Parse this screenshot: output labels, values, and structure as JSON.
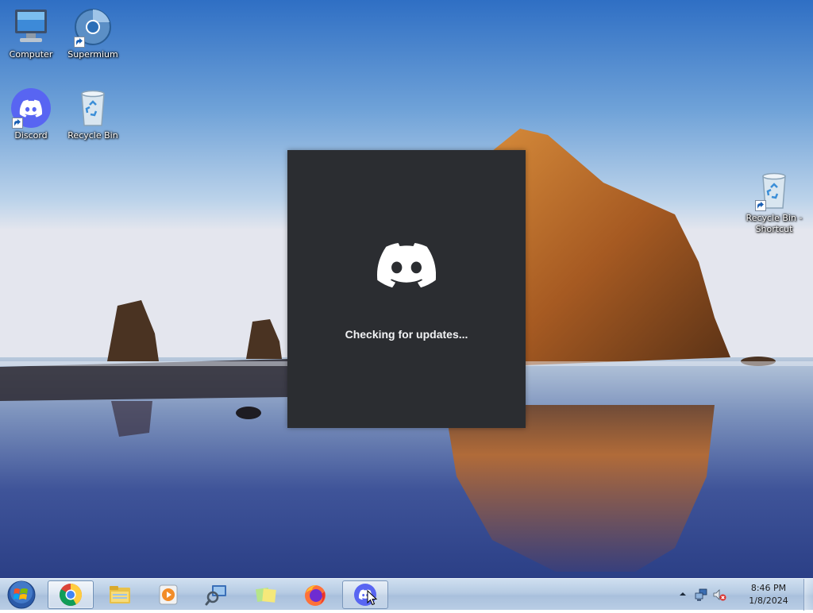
{
  "desktop": {
    "icons": [
      {
        "label": "Computer",
        "icon": "computer-icon",
        "shortcut": false
      },
      {
        "label": "Supermium",
        "icon": "supermium-icon",
        "shortcut": true
      },
      {
        "label": "Discord",
        "icon": "discord-icon",
        "shortcut": true
      },
      {
        "label": "Recycle Bin",
        "icon": "recycle-bin-icon",
        "shortcut": false
      },
      {
        "label": "Recycle Bin - Shortcut",
        "icon": "recycle-bin-icon",
        "shortcut": true
      }
    ],
    "wallpaper": "haystack-rock-sunset"
  },
  "splash": {
    "app": "Discord",
    "status": "Checking for updates...",
    "background": "#2b2d31",
    "logo_color": "#ffffff"
  },
  "taskbar": {
    "start": "start-orb-icon",
    "buttons": [
      {
        "icon": "chrome-icon",
        "state": "active"
      },
      {
        "icon": "file-explorer-icon",
        "state": "pinned"
      },
      {
        "icon": "media-player-icon",
        "state": "pinned"
      },
      {
        "icon": "search-program-icon",
        "state": "pinned"
      },
      {
        "icon": "sticky-notes-icon",
        "state": "pinned"
      },
      {
        "icon": "firefox-icon",
        "state": "pinned"
      },
      {
        "icon": "discord-icon",
        "state": "open"
      }
    ],
    "tray": {
      "icons": [
        "show-hidden-icons-icon",
        "network-icon",
        "volume-muted-icon"
      ],
      "time": "8:46 PM",
      "date": "1/8/2024"
    }
  },
  "colors": {
    "discord_blurple": "#5865f2",
    "splash_bg": "#2b2d31",
    "taskbar": "#b9cde5"
  }
}
